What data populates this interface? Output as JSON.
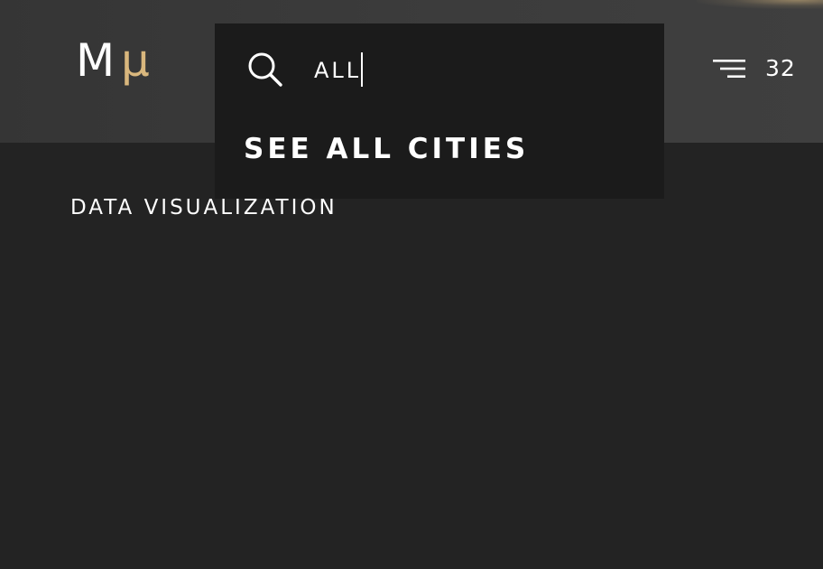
{
  "header": {
    "logo": {
      "letter_m": "M",
      "letter_mu": "μ"
    },
    "search": {
      "value": "ALL",
      "placeholder": "",
      "icon": "search-icon",
      "see_all_label": "SEE ALL CITIES"
    },
    "menu": {
      "icon": "menu-icon",
      "count": "32"
    }
  },
  "main": {
    "section_label": "DATA VISUALIZATION"
  },
  "colors": {
    "header_bg": "#3a3a3a",
    "page_bg": "#232323",
    "panel_bg": "#1b1b1b",
    "accent": "#d9b77d",
    "text": "#ffffff"
  }
}
